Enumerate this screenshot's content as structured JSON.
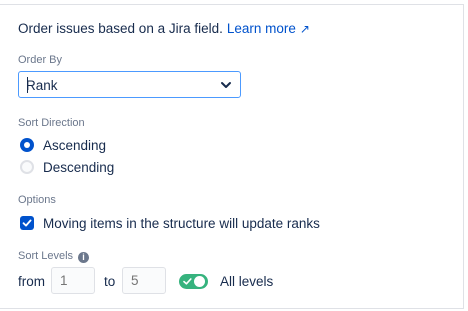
{
  "intro": {
    "text": "Order issues based on a Jira field.",
    "link_label": "Learn more",
    "link_icon": "external-link-arrow",
    "link_icon_glyph": "↗"
  },
  "order_by": {
    "label": "Order By",
    "selected": "Rank"
  },
  "sort_direction": {
    "label": "Sort Direction",
    "options": [
      {
        "label": "Ascending",
        "selected": true
      },
      {
        "label": "Descending",
        "selected": false
      }
    ]
  },
  "options": {
    "label": "Options",
    "update_ranks_label": "Moving items in the structure will update ranks",
    "update_ranks_checked": true
  },
  "sort_levels": {
    "label": "Sort Levels",
    "from_label": "from",
    "from_placeholder": "1",
    "to_label": "to",
    "to_placeholder": "5",
    "all_levels_label": "All levels",
    "all_levels_on": true
  },
  "colors": {
    "accent": "#0052cc",
    "focus_border": "#4c9aff",
    "toggle_on": "#36b37e",
    "text": "#172b4d",
    "muted": "#6b778c"
  }
}
